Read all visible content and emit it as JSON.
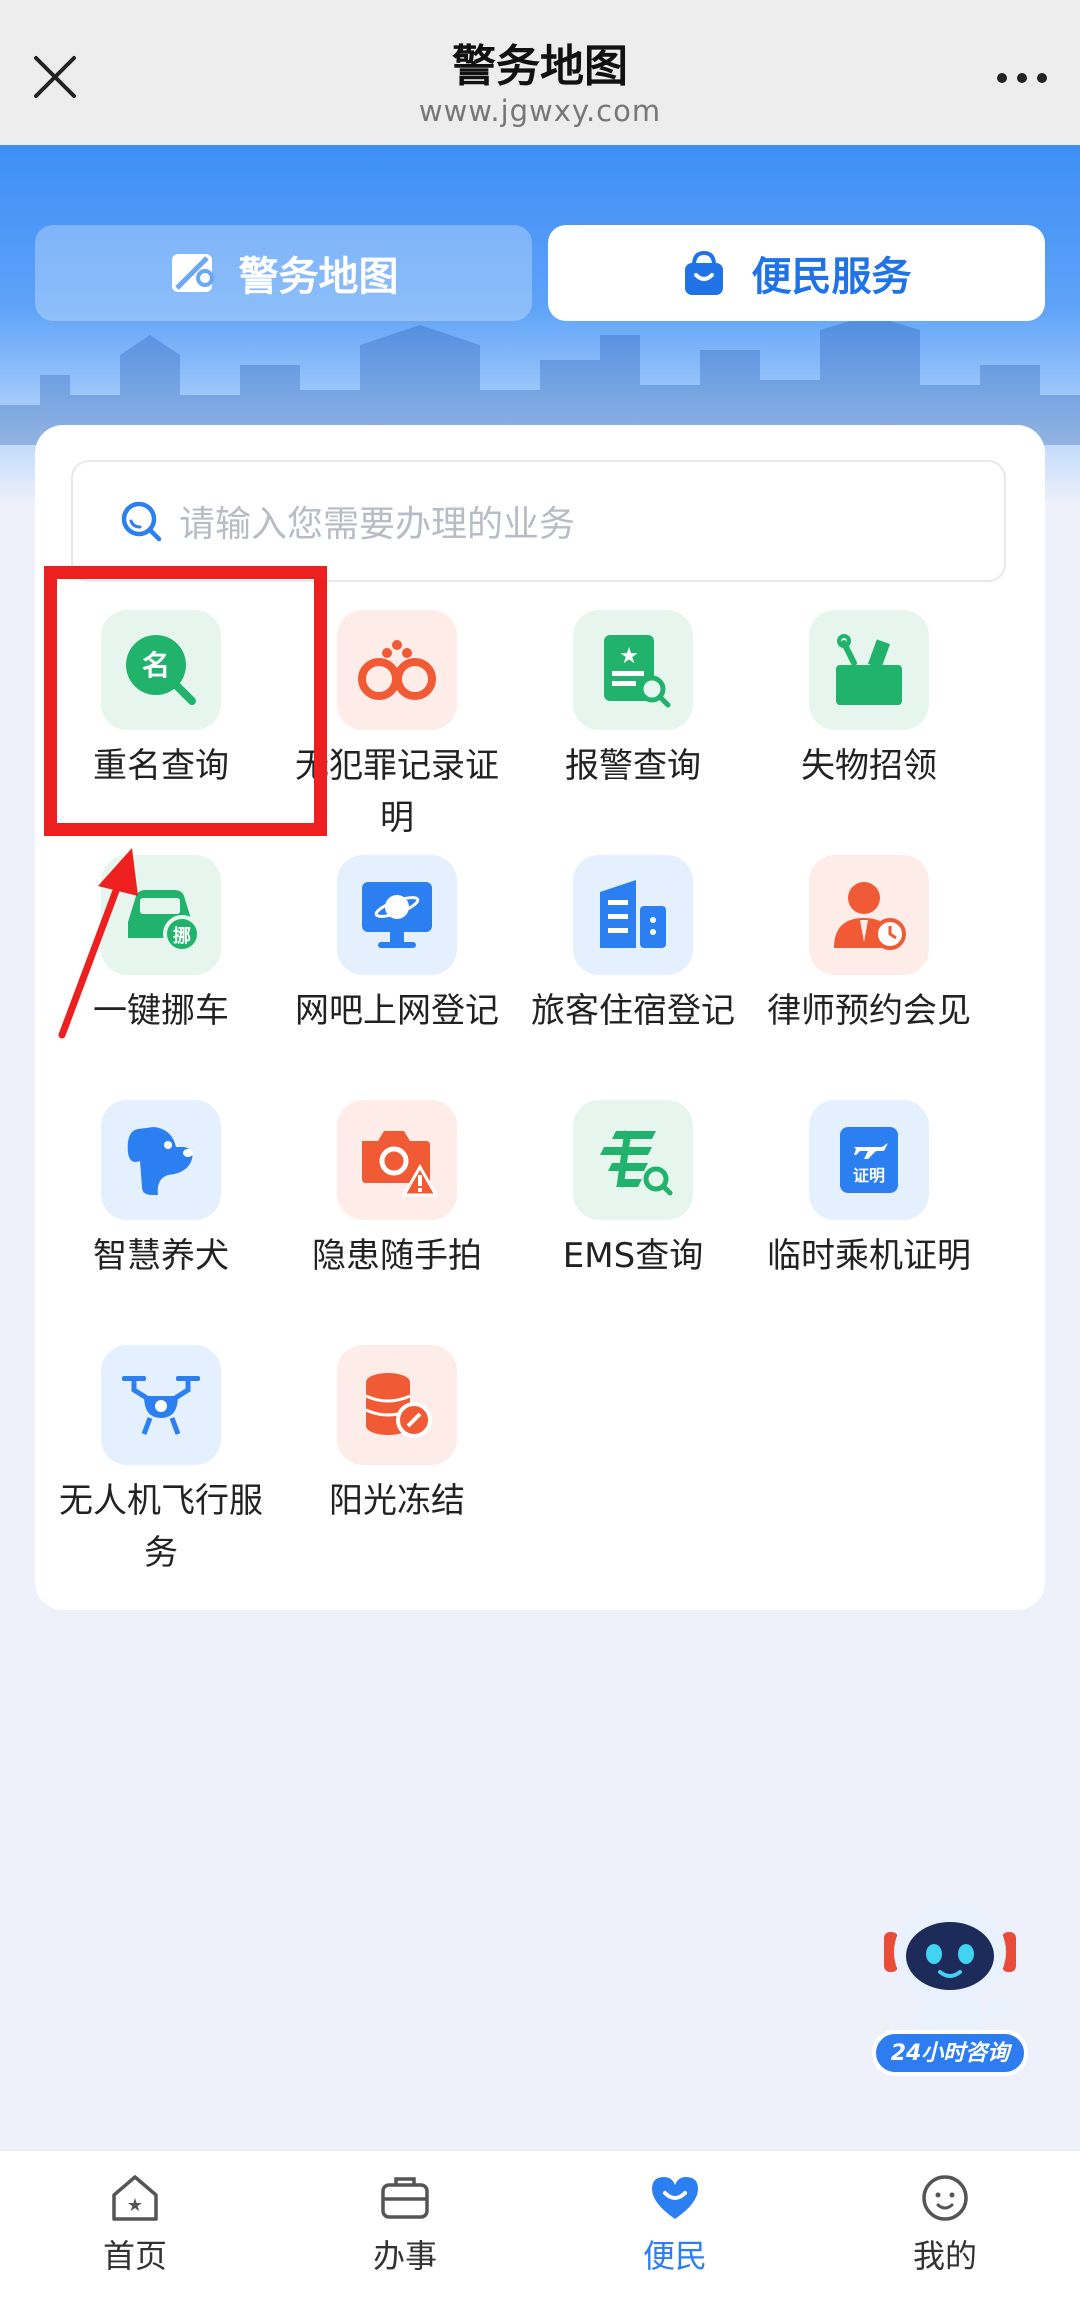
{
  "header": {
    "title": "警务地图",
    "subtitle": "www.jgwxy.com",
    "close_icon": "close-icon",
    "more_icon": "more-dots-icon"
  },
  "segments": [
    {
      "label": "警务地图",
      "icon": "map-icon",
      "selected": false
    },
    {
      "label": "便民服务",
      "icon": "bag-icon",
      "selected": true
    }
  ],
  "search": {
    "placeholder": "请输入您需要办理的业务"
  },
  "services": [
    {
      "label": "重名查询",
      "icon": "name-search-icon"
    },
    {
      "label": "无犯罪记录证明",
      "icon": "handcuffs-icon"
    },
    {
      "label": "报警查询",
      "icon": "report-search-icon"
    },
    {
      "label": "失物招领",
      "icon": "lost-found-icon"
    },
    {
      "label": "一键挪车",
      "icon": "move-car-icon"
    },
    {
      "label": "网吧上网登记",
      "icon": "internet-cafe-icon"
    },
    {
      "label": "旅客住宿登记",
      "icon": "hotel-icon"
    },
    {
      "label": "律师预约会见",
      "icon": "lawyer-icon"
    },
    {
      "label": "智慧养犬",
      "icon": "dog-icon"
    },
    {
      "label": "隐患随手拍",
      "icon": "camera-warning-icon"
    },
    {
      "label": "EMS查询",
      "icon": "ems-icon"
    },
    {
      "label": "临时乘机证明",
      "icon": "flight-certificate-icon"
    },
    {
      "label": "无人机飞行服务",
      "icon": "drone-icon"
    },
    {
      "label": "阳光冻结",
      "icon": "coins-freeze-icon"
    }
  ],
  "robot": {
    "badge": "24小时咨询"
  },
  "nav": [
    {
      "label": "首页",
      "icon": "home-star-icon",
      "active": false
    },
    {
      "label": "办事",
      "icon": "briefcase-icon",
      "active": false
    },
    {
      "label": "便民",
      "icon": "heart-icon",
      "active": true
    },
    {
      "label": "我的",
      "icon": "face-icon",
      "active": false
    }
  ],
  "colors": {
    "accent": "#2c7ff0",
    "green": "#21b36b",
    "orange": "#f05a35",
    "highlight": "#ee1f1f"
  }
}
